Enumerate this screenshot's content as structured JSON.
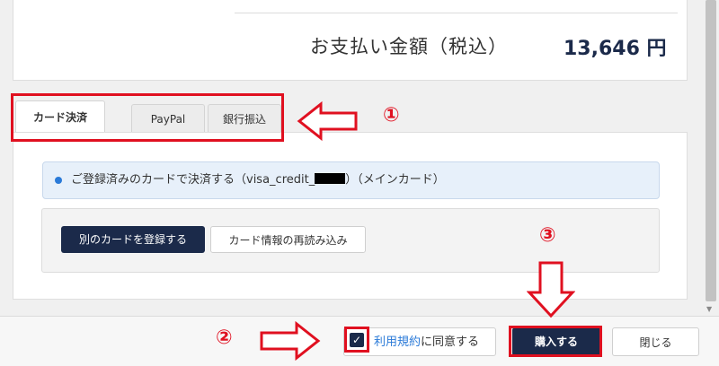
{
  "summary": {
    "total_label": "お支払い金額（税込）",
    "total_value": "13,646 円"
  },
  "payment_tabs": [
    {
      "label": "カード決済",
      "active": true
    },
    {
      "label": "PayPal",
      "active": false
    },
    {
      "label": "銀行振込",
      "active": false
    }
  ],
  "card_option": {
    "text_before": "ご登録済みのカードで決済する（visa_credit_",
    "text_after": "）（メインカード）"
  },
  "buttons": {
    "register_card": "別のカードを登録する",
    "reload_card": "カード情報の再読み込み",
    "purchase": "購入する",
    "close": "閉じる"
  },
  "agree": {
    "link_text": "利用規約",
    "suffix_text": "に同意する",
    "checked": true
  },
  "annotations": {
    "step1": "①",
    "step2": "②",
    "step3": "③"
  },
  "colors": {
    "primary": "#1b2a4a",
    "annotation_red": "#e01020",
    "link_blue": "#2a7ad8"
  }
}
